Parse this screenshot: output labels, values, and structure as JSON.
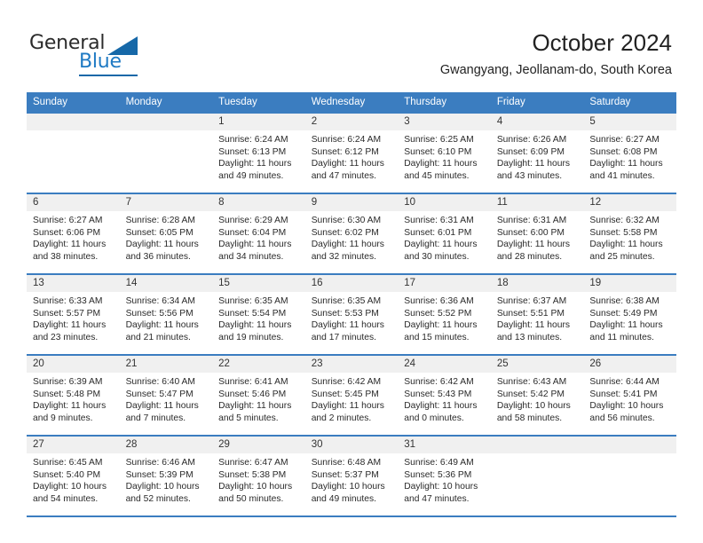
{
  "brand": {
    "word1": "General",
    "word2": "Blue",
    "logo_color": "#1668a8",
    "text_color": "#1f7ac4"
  },
  "header": {
    "title": "October 2024",
    "subtitle": "Gwangyang, Jeollanam-do, South Korea",
    "accent_color": "#3b7dc0"
  },
  "weekday_headers": [
    "Sunday",
    "Monday",
    "Tuesday",
    "Wednesday",
    "Thursday",
    "Friday",
    "Saturday"
  ],
  "labels": {
    "sunrise_prefix": "Sunrise:",
    "sunset_prefix": "Sunset:",
    "daylight_prefix": "Daylight:"
  },
  "weeks": [
    [
      {
        "day": "",
        "empty": true,
        "line1": "",
        "line2": "",
        "line3": "",
        "line4": ""
      },
      {
        "day": "",
        "empty": true,
        "line1": "",
        "line2": "",
        "line3": "",
        "line4": ""
      },
      {
        "day": "1",
        "line1": "Sunrise: 6:24 AM",
        "line2": "Sunset: 6:13 PM",
        "line3": "Daylight: 11 hours",
        "line4": "and 49 minutes."
      },
      {
        "day": "2",
        "line1": "Sunrise: 6:24 AM",
        "line2": "Sunset: 6:12 PM",
        "line3": "Daylight: 11 hours",
        "line4": "and 47 minutes."
      },
      {
        "day": "3",
        "line1": "Sunrise: 6:25 AM",
        "line2": "Sunset: 6:10 PM",
        "line3": "Daylight: 11 hours",
        "line4": "and 45 minutes."
      },
      {
        "day": "4",
        "line1": "Sunrise: 6:26 AM",
        "line2": "Sunset: 6:09 PM",
        "line3": "Daylight: 11 hours",
        "line4": "and 43 minutes."
      },
      {
        "day": "5",
        "line1": "Sunrise: 6:27 AM",
        "line2": "Sunset: 6:08 PM",
        "line3": "Daylight: 11 hours",
        "line4": "and 41 minutes."
      }
    ],
    [
      {
        "day": "6",
        "line1": "Sunrise: 6:27 AM",
        "line2": "Sunset: 6:06 PM",
        "line3": "Daylight: 11 hours",
        "line4": "and 38 minutes."
      },
      {
        "day": "7",
        "line1": "Sunrise: 6:28 AM",
        "line2": "Sunset: 6:05 PM",
        "line3": "Daylight: 11 hours",
        "line4": "and 36 minutes."
      },
      {
        "day": "8",
        "line1": "Sunrise: 6:29 AM",
        "line2": "Sunset: 6:04 PM",
        "line3": "Daylight: 11 hours",
        "line4": "and 34 minutes."
      },
      {
        "day": "9",
        "line1": "Sunrise: 6:30 AM",
        "line2": "Sunset: 6:02 PM",
        "line3": "Daylight: 11 hours",
        "line4": "and 32 minutes."
      },
      {
        "day": "10",
        "line1": "Sunrise: 6:31 AM",
        "line2": "Sunset: 6:01 PM",
        "line3": "Daylight: 11 hours",
        "line4": "and 30 minutes."
      },
      {
        "day": "11",
        "line1": "Sunrise: 6:31 AM",
        "line2": "Sunset: 6:00 PM",
        "line3": "Daylight: 11 hours",
        "line4": "and 28 minutes."
      },
      {
        "day": "12",
        "line1": "Sunrise: 6:32 AM",
        "line2": "Sunset: 5:58 PM",
        "line3": "Daylight: 11 hours",
        "line4": "and 25 minutes."
      }
    ],
    [
      {
        "day": "13",
        "line1": "Sunrise: 6:33 AM",
        "line2": "Sunset: 5:57 PM",
        "line3": "Daylight: 11 hours",
        "line4": "and 23 minutes."
      },
      {
        "day": "14",
        "line1": "Sunrise: 6:34 AM",
        "line2": "Sunset: 5:56 PM",
        "line3": "Daylight: 11 hours",
        "line4": "and 21 minutes."
      },
      {
        "day": "15",
        "line1": "Sunrise: 6:35 AM",
        "line2": "Sunset: 5:54 PM",
        "line3": "Daylight: 11 hours",
        "line4": "and 19 minutes."
      },
      {
        "day": "16",
        "line1": "Sunrise: 6:35 AM",
        "line2": "Sunset: 5:53 PM",
        "line3": "Daylight: 11 hours",
        "line4": "and 17 minutes."
      },
      {
        "day": "17",
        "line1": "Sunrise: 6:36 AM",
        "line2": "Sunset: 5:52 PM",
        "line3": "Daylight: 11 hours",
        "line4": "and 15 minutes."
      },
      {
        "day": "18",
        "line1": "Sunrise: 6:37 AM",
        "line2": "Sunset: 5:51 PM",
        "line3": "Daylight: 11 hours",
        "line4": "and 13 minutes."
      },
      {
        "day": "19",
        "line1": "Sunrise: 6:38 AM",
        "line2": "Sunset: 5:49 PM",
        "line3": "Daylight: 11 hours",
        "line4": "and 11 minutes."
      }
    ],
    [
      {
        "day": "20",
        "line1": "Sunrise: 6:39 AM",
        "line2": "Sunset: 5:48 PM",
        "line3": "Daylight: 11 hours",
        "line4": "and 9 minutes."
      },
      {
        "day": "21",
        "line1": "Sunrise: 6:40 AM",
        "line2": "Sunset: 5:47 PM",
        "line3": "Daylight: 11 hours",
        "line4": "and 7 minutes."
      },
      {
        "day": "22",
        "line1": "Sunrise: 6:41 AM",
        "line2": "Sunset: 5:46 PM",
        "line3": "Daylight: 11 hours",
        "line4": "and 5 minutes."
      },
      {
        "day": "23",
        "line1": "Sunrise: 6:42 AM",
        "line2": "Sunset: 5:45 PM",
        "line3": "Daylight: 11 hours",
        "line4": "and 2 minutes."
      },
      {
        "day": "24",
        "line1": "Sunrise: 6:42 AM",
        "line2": "Sunset: 5:43 PM",
        "line3": "Daylight: 11 hours",
        "line4": "and 0 minutes."
      },
      {
        "day": "25",
        "line1": "Sunrise: 6:43 AM",
        "line2": "Sunset: 5:42 PM",
        "line3": "Daylight: 10 hours",
        "line4": "and 58 minutes."
      },
      {
        "day": "26",
        "line1": "Sunrise: 6:44 AM",
        "line2": "Sunset: 5:41 PM",
        "line3": "Daylight: 10 hours",
        "line4": "and 56 minutes."
      }
    ],
    [
      {
        "day": "27",
        "line1": "Sunrise: 6:45 AM",
        "line2": "Sunset: 5:40 PM",
        "line3": "Daylight: 10 hours",
        "line4": "and 54 minutes."
      },
      {
        "day": "28",
        "line1": "Sunrise: 6:46 AM",
        "line2": "Sunset: 5:39 PM",
        "line3": "Daylight: 10 hours",
        "line4": "and 52 minutes."
      },
      {
        "day": "29",
        "line1": "Sunrise: 6:47 AM",
        "line2": "Sunset: 5:38 PM",
        "line3": "Daylight: 10 hours",
        "line4": "and 50 minutes."
      },
      {
        "day": "30",
        "line1": "Sunrise: 6:48 AM",
        "line2": "Sunset: 5:37 PM",
        "line3": "Daylight: 10 hours",
        "line4": "and 49 minutes."
      },
      {
        "day": "31",
        "line1": "Sunrise: 6:49 AM",
        "line2": "Sunset: 5:36 PM",
        "line3": "Daylight: 10 hours",
        "line4": "and 47 minutes."
      },
      {
        "day": "",
        "empty": true,
        "line1": "",
        "line2": "",
        "line3": "",
        "line4": ""
      },
      {
        "day": "",
        "empty": true,
        "line1": "",
        "line2": "",
        "line3": "",
        "line4": ""
      }
    ]
  ]
}
